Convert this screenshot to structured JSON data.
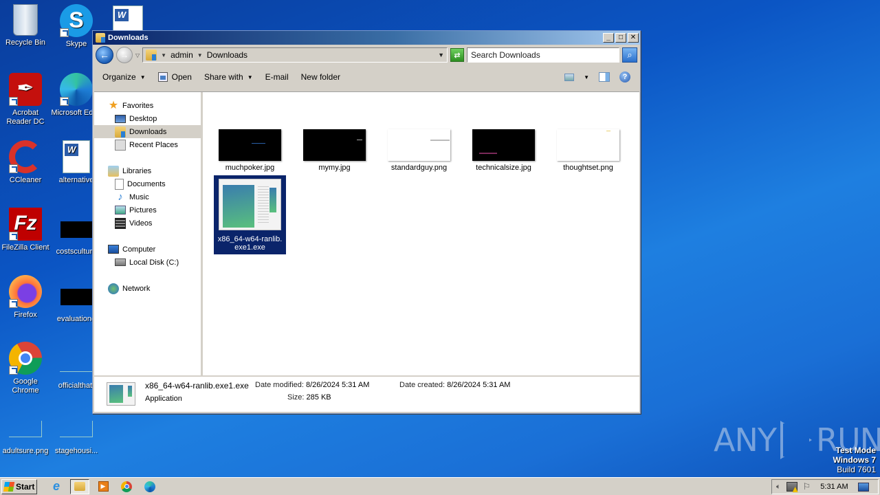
{
  "desktop": {
    "icons": [
      {
        "label": "Recycle Bin"
      },
      {
        "label": "Skype"
      },
      {
        "label": "Acrobat Reader DC"
      },
      {
        "label": "Microsoft Edge"
      },
      {
        "label": "CCleaner"
      },
      {
        "label": "alternative"
      },
      {
        "label": "FileZilla Client"
      },
      {
        "label": "costsculture"
      },
      {
        "label": "Firefox"
      },
      {
        "label": "evaluationg"
      },
      {
        "label": "Google Chrome"
      },
      {
        "label": "officialthat."
      },
      {
        "label": "adultsure.png"
      },
      {
        "label": "stagehousi..."
      }
    ]
  },
  "window": {
    "title": "Downloads",
    "controls": {
      "minimize": "_",
      "maximize": "□",
      "close": "✕"
    },
    "address": {
      "crumbs": [
        "admin",
        "Downloads"
      ]
    },
    "search": {
      "placeholder": "Search Downloads"
    },
    "toolbar": {
      "organize": "Organize",
      "open": "Open",
      "share_with": "Share with",
      "email": "E-mail",
      "new_folder": "New folder"
    },
    "nav": {
      "favorites": "Favorites",
      "desktop": "Desktop",
      "downloads": "Downloads",
      "recent": "Recent Places",
      "libraries": "Libraries",
      "documents": "Documents",
      "music": "Music",
      "pictures": "Pictures",
      "videos": "Videos",
      "computer": "Computer",
      "local_disk": "Local Disk (C:)",
      "network": "Network"
    },
    "files": [
      {
        "name": "muchpoker.jpg"
      },
      {
        "name": "mymy.jpg"
      },
      {
        "name": "standardguy.png"
      },
      {
        "name": "technicalsize.jpg"
      },
      {
        "name": "thoughtset.png"
      },
      {
        "name_line1": "x86_64-w64-ranlib.",
        "name_line2": "exe1.exe",
        "selected": true
      }
    ],
    "details": {
      "filename": "x86_64-w64-ranlib.exe1.exe",
      "type": "Application",
      "date_modified_label": "Date modified:",
      "date_modified": "8/26/2024 5:31 AM",
      "size_label": "Size:",
      "size": "285 KB",
      "date_created_label": "Date created:",
      "date_created": "8/26/2024 5:31 AM"
    }
  },
  "taskbar": {
    "start": "Start",
    "clock": "5:31 AM"
  },
  "watermark": {
    "left": "ANY",
    "right": "RUN",
    "line1": "Test Mode",
    "line2": "Windows 7",
    "line3": "Build 7601"
  }
}
